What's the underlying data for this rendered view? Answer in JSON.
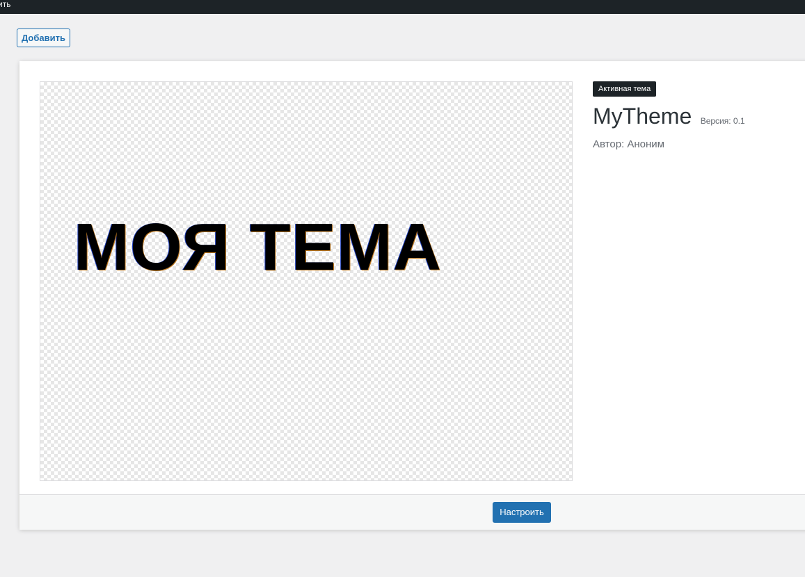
{
  "admin_bar": {
    "text": "ить"
  },
  "page": {
    "add_button_label": "Добавить"
  },
  "theme": {
    "screenshot_text": "МОЯ ТЕМА",
    "active_badge": "Активная тема",
    "name": "MyTheme",
    "version": "Версия: 0.1",
    "author": "Автор: Аноним",
    "customize_label": "Настроить"
  },
  "colors": {
    "accent": "#2271b1",
    "admin_bar_bg": "#1d2327",
    "page_bg": "#f0f0f1"
  }
}
